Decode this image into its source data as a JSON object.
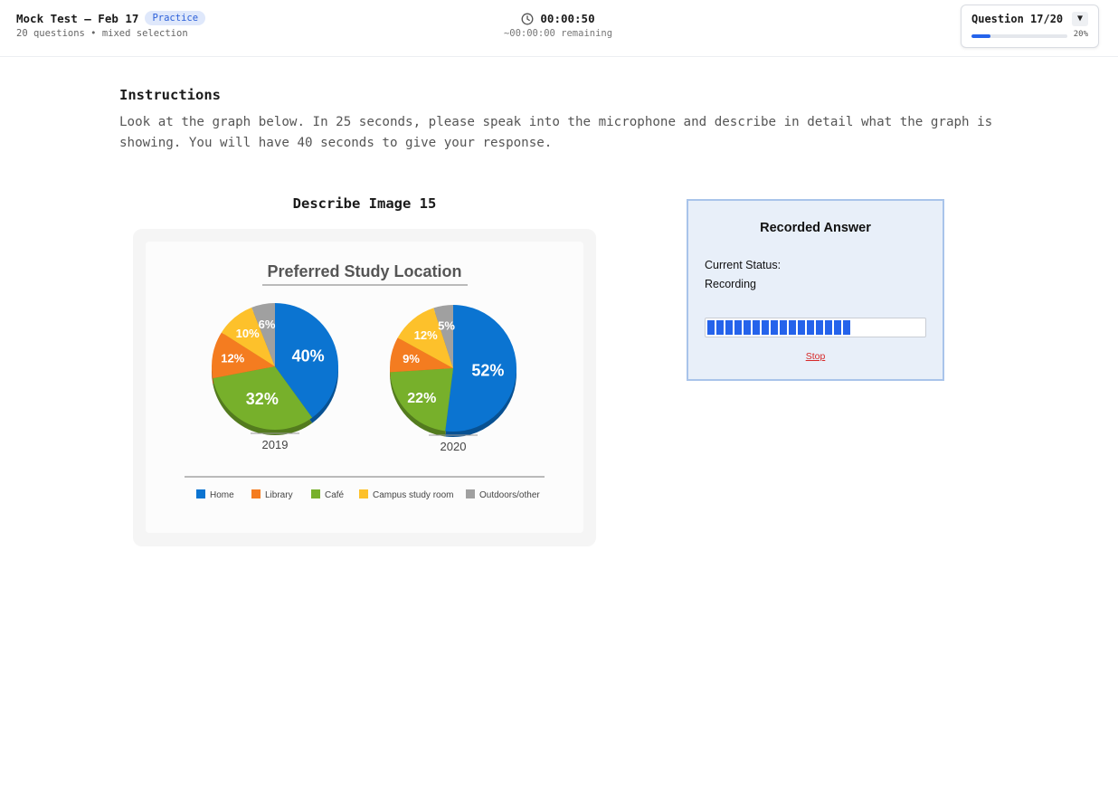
{
  "header": {
    "title": "Mock Test – Feb 17",
    "badge": "Practice",
    "subtitle": "20 questions • mixed selection",
    "timer": "00:00:50",
    "remaining": "~00:00:00 remaining",
    "question_label": "Question 17/20",
    "dropdown_glyph": "▼",
    "progress_pct_label": "20%",
    "progress_fraction": 0.2,
    "accent_color": "#2563eb"
  },
  "instructions": {
    "heading": "Instructions",
    "text": "Look at the graph below. In 25 seconds, please speak into the microphone and describe in detail what the graph is showing. You will have 40 seconds to give your response."
  },
  "image_panel": {
    "title": "Describe Image 15"
  },
  "chart_data": {
    "type": "pie",
    "title": "Preferred Study Location",
    "categories": [
      "Home",
      "Library",
      "Café",
      "Campus study room",
      "Outdoors/other"
    ],
    "colors": [
      "#0b74d1",
      "#f47c20",
      "#77b02b",
      "#fdc12b",
      "#a0a0a0"
    ],
    "series": [
      {
        "name": "2019",
        "values": [
          40,
          12,
          32,
          10,
          6
        ]
      },
      {
        "name": "2020",
        "values": [
          52,
          9,
          22,
          12,
          5
        ]
      }
    ],
    "slice_order": [
      0,
      2,
      1,
      3,
      4
    ],
    "legend_position": "bottom"
  },
  "recorder": {
    "title": "Recorded Answer",
    "status_label": "Current Status:",
    "status": "Recording",
    "level_fraction": 0.68,
    "stop_label": "Stop"
  }
}
